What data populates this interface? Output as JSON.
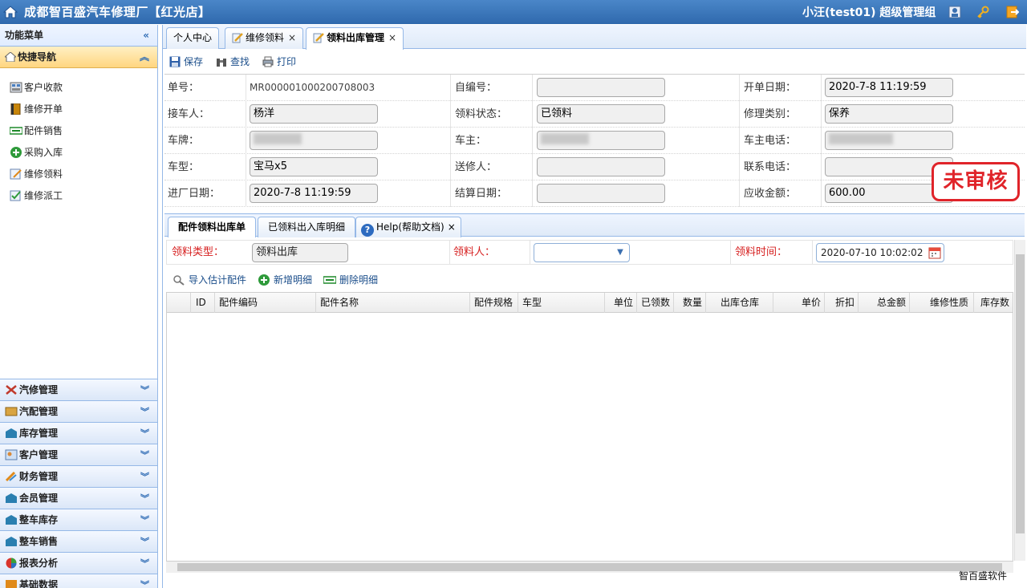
{
  "header": {
    "title": "成都智百盛汽车修理厂【红光店】",
    "user": "小汪(test01) 超级管理组",
    "icons": [
      "home-icon",
      "user-card-icon",
      "key-icon",
      "logout-icon"
    ]
  },
  "sidebar": {
    "heading": "功能菜单",
    "collapse_glyph": "«",
    "quick": {
      "label": "快捷导航",
      "arrow": "︽"
    },
    "quick_items": [
      {
        "label": "客户收款",
        "icon": "cashier-icon"
      },
      {
        "label": "维修开单",
        "icon": "book-icon"
      },
      {
        "label": "配件销售",
        "icon": "minus-box-icon"
      },
      {
        "label": "采购入库",
        "icon": "plus-icon"
      },
      {
        "label": "维修领料",
        "icon": "edit-form-icon"
      },
      {
        "label": "维修派工",
        "icon": "dispatch-icon"
      }
    ],
    "sections": [
      {
        "label": "汽修管理",
        "arrow": "︾"
      },
      {
        "label": "汽配管理",
        "arrow": "︾"
      },
      {
        "label": "库存管理",
        "arrow": "︾"
      },
      {
        "label": "客户管理",
        "arrow": "︾"
      },
      {
        "label": "财务管理",
        "arrow": "︾"
      },
      {
        "label": "会员管理",
        "arrow": "︾"
      },
      {
        "label": "整车库存",
        "arrow": "︾"
      },
      {
        "label": "整车销售",
        "arrow": "︾"
      },
      {
        "label": "报表分析",
        "arrow": "︾"
      },
      {
        "label": "基础数据",
        "arrow": "︾"
      }
    ]
  },
  "tabs": [
    {
      "label": "个人中心",
      "closable": false
    },
    {
      "label": "维修领料",
      "closable": true
    },
    {
      "label": "领料出库管理",
      "closable": true,
      "active": true
    }
  ],
  "close_glyph": "×",
  "toolbar": {
    "save": "保存",
    "search": "查找",
    "print": "打印"
  },
  "form": {
    "order_no_label": "单号：",
    "order_no": "MR000001000200708003",
    "self_no_label": "自编号：",
    "self_no": "",
    "open_date_label": "开单日期：",
    "open_date": "2020-7-8 11:19:59",
    "receiver_label": "接车人：",
    "receiver": "杨洋",
    "status_label": "领料状态：",
    "status": "已领料",
    "repair_type_label": "修理类别：",
    "repair_type": "保养",
    "plate_label": "车牌：",
    "owner_label": "车主：",
    "owner_phone_label": "车主电话：",
    "model_label": "车型：",
    "model": "宝马x5",
    "sender_label": "送修人：",
    "sender": "",
    "contact_label": "联系电话：",
    "contact": "",
    "entry_date_label": "进厂日期：",
    "entry_date": "2020-7-8 11:19:59",
    "settle_date_label": "结算日期：",
    "settle_date": "",
    "amount_label": "应收金额：",
    "amount": "600.00",
    "stamp": "未审核"
  },
  "subtabs": [
    {
      "label": "配件领料出库单",
      "active": true
    },
    {
      "label": "已领料出入库明细"
    },
    {
      "label": "Help(帮助文档)",
      "icon": "help-icon",
      "closable": true
    }
  ],
  "subform": {
    "type_label": "领料类型：",
    "type": "领料出库",
    "person_label": "领料人：",
    "person": "",
    "time_label": "领料时间：",
    "time": "2020-07-10 10:02:02"
  },
  "grid_toolbar": {
    "import": "导入估计配件",
    "add": "新增明细",
    "delete": "删除明细"
  },
  "grid": {
    "columns": [
      "ID",
      "配件编码",
      "配件名称",
      "配件规格",
      "车型",
      "单位",
      "已领数",
      "数量",
      "出库仓库",
      "单价",
      "折扣",
      "总金额",
      "维修性质",
      "库存数"
    ],
    "rows": []
  },
  "footer": "智百盛软件",
  "colors": {
    "header": "#2f69ad",
    "accent": "#95b8e7",
    "required": "#d62020",
    "stamp": "#e0242a"
  }
}
